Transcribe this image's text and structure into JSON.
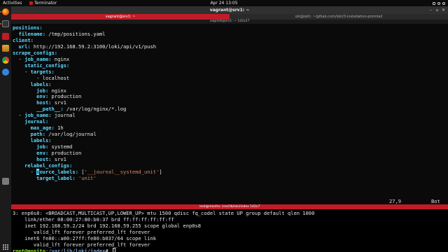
{
  "topbar": {
    "activities": "Activities",
    "app_name": "Terminator",
    "clock": "Apr 24 13:05",
    "tray_icons": [
      "network-icon",
      "volume-icon",
      "power-icon"
    ]
  },
  "dock": {
    "items": [
      "firefox-icon",
      "terminal-icon",
      "rhythmbox-icon",
      "files-icon",
      "chrome-icon",
      "help-icon",
      "trash-icon"
    ]
  },
  "window": {
    "title": "vagrant@srv1: ~",
    "tabs": [
      {
        "label": "vagrant@srv1: ~",
        "active": true
      },
      {
        "label": "oki@okti: ~/gitlab.com/loki/3-installation-promtail",
        "active": false
      }
    ],
    "subtitle": "vagrant@srv1: ~ 142x27",
    "controls": [
      "minimize",
      "maximize",
      "close"
    ]
  },
  "editor": {
    "lines": [
      [
        {
          "t": "positions:",
          "c": "k"
        }
      ],
      [
        {
          "t": "  filename:",
          "c": "k"
        },
        {
          "t": " /tmp/positions.yaml",
          "c": "v"
        }
      ],
      [
        {
          "t": "client:",
          "c": "k"
        }
      ],
      [
        {
          "t": "  url:",
          "c": "k"
        },
        {
          "t": " http://192.168.59.2:3100/loki/api/v1/push",
          "c": "v"
        }
      ],
      [
        {
          "t": "scrape_configs:",
          "c": "k"
        }
      ],
      [
        {
          "t": "  - ",
          "c": "dash"
        },
        {
          "t": "job_name:",
          "c": "k"
        },
        {
          "t": " nginx",
          "c": "v"
        }
      ],
      [
        {
          "t": "    static_configs:",
          "c": "k"
        }
      ],
      [
        {
          "t": "    - ",
          "c": "dash"
        },
        {
          "t": "targets:",
          "c": "k"
        }
      ],
      [
        {
          "t": "        - localhost",
          "c": "v"
        }
      ],
      [
        {
          "t": "      labels:",
          "c": "k"
        }
      ],
      [
        {
          "t": "        job:",
          "c": "k"
        },
        {
          "t": " nginx",
          "c": "v"
        }
      ],
      [
        {
          "t": "        env:",
          "c": "k"
        },
        {
          "t": " production",
          "c": "v"
        }
      ],
      [
        {
          "t": "        host:",
          "c": "k"
        },
        {
          "t": " srv1",
          "c": "v"
        }
      ],
      [
        {
          "t": "        __path__:",
          "c": "k"
        },
        {
          "t": " /var/log/nginx/*.log",
          "c": "v"
        }
      ],
      [
        {
          "t": "  - ",
          "c": "dash"
        },
        {
          "t": "job_name:",
          "c": "k"
        },
        {
          "t": " journal",
          "c": "v"
        }
      ],
      [
        {
          "t": "    journal:",
          "c": "k"
        }
      ],
      [
        {
          "t": "      max_age:",
          "c": "k"
        },
        {
          "t": " 1h",
          "c": "v"
        }
      ],
      [
        {
          "t": "      path:",
          "c": "k"
        },
        {
          "t": " /var/log/journal",
          "c": "v"
        }
      ],
      [
        {
          "t": "      labels:",
          "c": "k"
        }
      ],
      [
        {
          "t": "        job:",
          "c": "k"
        },
        {
          "t": " systemd",
          "c": "v"
        }
      ],
      [
        {
          "t": "        env:",
          "c": "k"
        },
        {
          "t": " production",
          "c": "v"
        }
      ],
      [
        {
          "t": "        host:",
          "c": "k"
        },
        {
          "t": " srv1",
          "c": "v"
        }
      ],
      [
        {
          "t": "    relabel_configs:",
          "c": "k"
        }
      ],
      [
        {
          "t": "      - ",
          "c": "dash"
        },
        {
          "t": "s",
          "c": "cursor"
        },
        {
          "t": "ource_labels:",
          "c": "k"
        },
        {
          "t": " [",
          "c": "v"
        },
        {
          "t": "'__journal__systemd_unit'",
          "c": "s"
        },
        {
          "t": "]",
          "c": "v"
        }
      ],
      [
        {
          "t": "        target_label:",
          "c": "k"
        },
        {
          "t": " ",
          "c": "v"
        },
        {
          "t": "'unit'",
          "c": "s"
        }
      ]
    ],
    "cursor_pos": "27,9",
    "scroll_pos": "Bot"
  },
  "split_title": "root@monito: /var/lib/loki/index 142x7",
  "shell": {
    "lines": [
      "3: enp0s8: <BROADCAST,MULTICAST,UP,LOWER_UP> mtu 1500 qdisc fq_codel state UP group default qlen 1000",
      "    link/ether 08:00:27:80:b0:37 brd ff:ff:ff:ff:ff:ff",
      "    inet 192.168.59.2/24 brd 192.168.59.255 scope global enp0s8",
      "       valid_lft forever preferred_lft forever",
      "    inet6 fe80::a00:27ff:fe80:b037/64 scope link",
      "       valid_lft forever preferred_lft forever"
    ],
    "prompt_user": "root@monito",
    "prompt_sep": ":",
    "prompt_path": "/var/lib/loki/index",
    "prompt_symbol": "# "
  },
  "colors": {
    "accent_red": "#c01c28",
    "yaml_key": "#5fd7ff",
    "yaml_string": "#d7875f",
    "prompt_user": "#8ae234",
    "prompt_path": "#729fcf"
  }
}
